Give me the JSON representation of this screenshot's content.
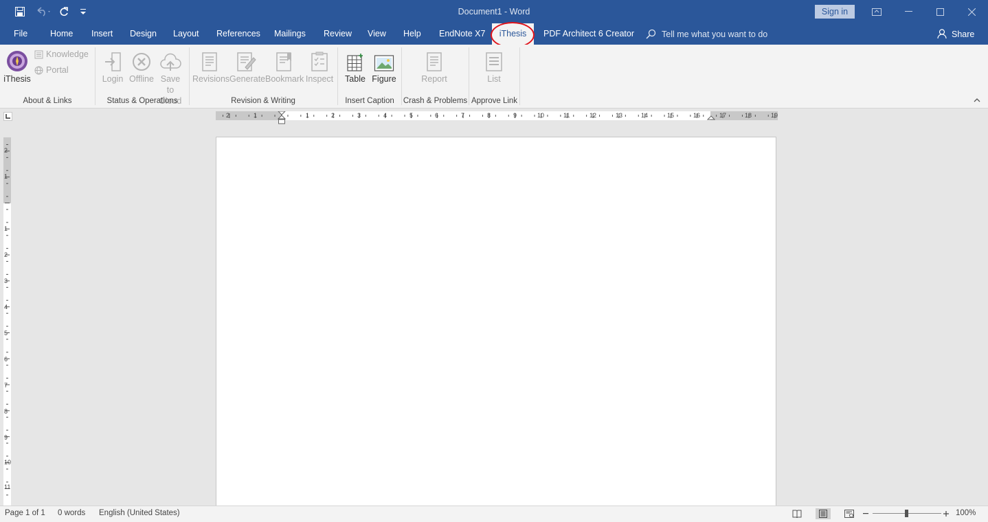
{
  "window": {
    "title": "Document1  -  Word",
    "sign_in": "Sign in"
  },
  "tabs": [
    {
      "label": "File"
    },
    {
      "label": "Home"
    },
    {
      "label": "Insert"
    },
    {
      "label": "Design"
    },
    {
      "label": "Layout"
    },
    {
      "label": "References"
    },
    {
      "label": "Mailings"
    },
    {
      "label": "Review"
    },
    {
      "label": "View"
    },
    {
      "label": "Help"
    },
    {
      "label": "EndNote X7"
    },
    {
      "label": "iThesis"
    },
    {
      "label": "PDF Architect 6 Creator"
    }
  ],
  "active_tab": "iThesis",
  "tell_me": "Tell me what you want to do",
  "share": "Share",
  "ribbon": {
    "ithesis": "iThesis",
    "knowledge": "Knowledge",
    "portal": "Portal",
    "login": "Login",
    "offline": "Offline",
    "save_to_cloud_1": "Save to",
    "save_to_cloud_2": "Cloud",
    "revisions": "Revisions",
    "generate": "Generate",
    "bookmark": "Bookmark",
    "inspect": "Inspect",
    "table": "Table",
    "figure": "Figure",
    "report": "Report",
    "list": "List",
    "groups": {
      "about": "About & Links",
      "status": "Status & Operations",
      "revision": "Revision & Writing",
      "caption": "Insert Caption",
      "crash": "Crash & Problems",
      "approve": "Approve Link"
    }
  },
  "ruler": {
    "h_labels": [
      "2",
      "1",
      "1",
      "2",
      "3",
      "4",
      "5",
      "6",
      "7",
      "8",
      "9",
      "10",
      "11",
      "12",
      "13",
      "14",
      "15",
      "16",
      "17",
      "18",
      "19"
    ],
    "v_labels": [
      "2",
      "1",
      "1",
      "2",
      "3",
      "4",
      "5",
      "6",
      "7",
      "8",
      "9",
      "10",
      "11"
    ]
  },
  "status": {
    "page": "Page 1 of 1",
    "words": "0 words",
    "language": "English (United States)",
    "zoom": "100%"
  },
  "colors": {
    "brand": "#2b579a",
    "ribbon_bg": "#f3f3f3",
    "highlight_ring": "#e0141b"
  }
}
